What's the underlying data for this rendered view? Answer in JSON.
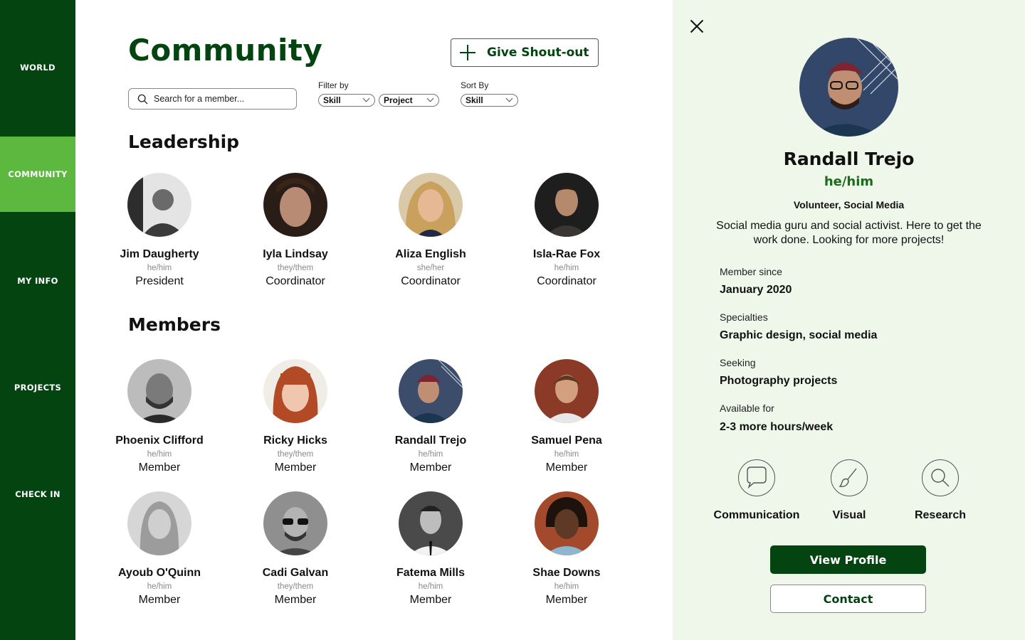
{
  "sidebar": {
    "items": [
      {
        "label": "WORLD"
      },
      {
        "label": "COMMUNITY",
        "active": true
      },
      {
        "label": "MY INFO"
      },
      {
        "label": "PROJECTS"
      },
      {
        "label": "CHECK IN"
      }
    ],
    "background": "#034411",
    "active_color": "#5cb83f"
  },
  "header": {
    "title": "Community",
    "shoutout_label": "Give Shout-out",
    "shoutout_icon": "plus-icon"
  },
  "search": {
    "placeholder": "Search for a member...",
    "value": ""
  },
  "filters": {
    "filter_label": "Filter by",
    "filter1_value": "Skill",
    "filter2_value": "Project",
    "sort_label": "Sort By",
    "sort_value": "Skill"
  },
  "leadership": {
    "title": "Leadership",
    "people": [
      {
        "name": "Jim Daugherty",
        "pronouns": "he/him",
        "role": "President"
      },
      {
        "name": "Iyla Lindsay",
        "pronouns": "they/them",
        "role": "Coordinator"
      },
      {
        "name": "Aliza English",
        "pronouns": "she/her",
        "role": "Coordinator"
      },
      {
        "name": "Isla-Rae Fox",
        "pronouns": "he/him",
        "role": "Coordinator"
      }
    ]
  },
  "members": {
    "title": "Members",
    "people": [
      {
        "name": "Phoenix Clifford",
        "pronouns": "he/him",
        "role": "Member"
      },
      {
        "name": "Ricky Hicks",
        "pronouns": "they/them",
        "role": "Member"
      },
      {
        "name": "Randall Trejo",
        "pronouns": "he/him",
        "role": "Member"
      },
      {
        "name": "Samuel Pena",
        "pronouns": "he/him",
        "role": "Member"
      },
      {
        "name": "Ayoub O'Quinn",
        "pronouns": "he/him",
        "role": "Member"
      },
      {
        "name": "Cadi Galvan",
        "pronouns": "they/them",
        "role": "Member"
      },
      {
        "name": "Fatema Mills",
        "pronouns": "he/him",
        "role": "Member"
      },
      {
        "name": "Shae Downs",
        "pronouns": "he/him",
        "role": "Member"
      }
    ]
  },
  "detail": {
    "name": "Randall Trejo",
    "pronouns": "he/him",
    "role": "Volunteer, Social Media",
    "bio": "Social media guru and social activist. Here to get the work done. Looking for more projects!",
    "fields": [
      {
        "label": "Member since",
        "value": "January 2020"
      },
      {
        "label": "Specialties",
        "value": "Graphic design, social media"
      },
      {
        "label": "Seeking",
        "value": "Photography projects"
      },
      {
        "label": "Available for",
        "value": "2-3 more hours/week"
      }
    ],
    "skills": [
      {
        "label": "Communication",
        "icon": "speech-bubble-icon"
      },
      {
        "label": "Visual",
        "icon": "paintbrush-icon"
      },
      {
        "label": "Research",
        "icon": "magnifier-icon"
      }
    ],
    "view_profile_label": "View Profile",
    "contact_label": "Contact",
    "panel_background": "#eef7ea"
  }
}
